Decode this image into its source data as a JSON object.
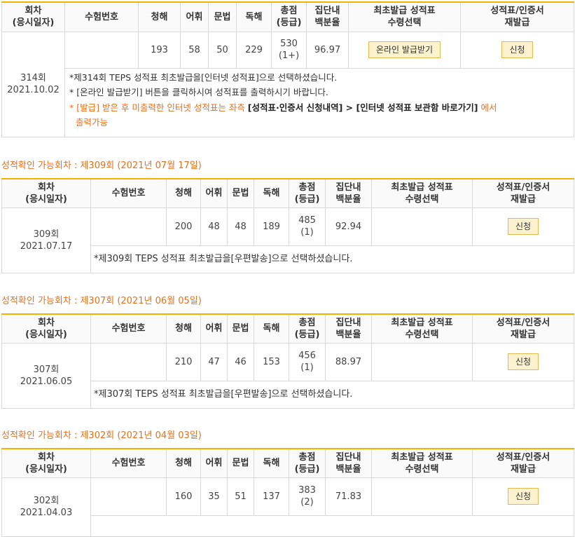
{
  "headers": {
    "session": [
      "회차",
      "(응시일자)"
    ],
    "exam_no": "수험번호",
    "listening": "청해",
    "vocab": "어휘",
    "grammar": "문법",
    "reading": "독해",
    "total": [
      "총점",
      "(등급)"
    ],
    "percentile": [
      "집단내",
      "백분율"
    ],
    "first_issue": [
      "최초발급 성적표",
      "수령선택"
    ],
    "reissue": [
      "성적표/인증서",
      "재발급"
    ]
  },
  "records": [
    {
      "session": "314회",
      "date": "2021.10.02",
      "exam_no": "",
      "listening": "193",
      "vocab": "58",
      "grammar": "50",
      "reading": "229",
      "total": "530",
      "grade": "(1+)",
      "percentile": "96.97",
      "first_issue_button": "온라인 발급받기",
      "reissue_button": "신청",
      "notes": {
        "line1": "*제314회 TEPS 성적표 최초발급을[인터넷 성적표]으로 선택하셨습니다.",
        "line2": "* [온라인 발급받기] 버튼을 클릭하시여 성적표를 출력하시기 바랍니다.",
        "line3_prefix": "* [발급] 받은 후 미출력한 인터넷 성적표는 좌측 ",
        "line3_bold1": "[성적표·인증서 신청내역]",
        "line3_arrow": " > ",
        "line3_bold2": "[인터넷 성적표 보관함 바로가기]",
        "line3_suffix": " 에서",
        "line4": "출력가능"
      }
    }
  ],
  "sections": [
    {
      "title": "성적확인 가능회차 : 제309회 (2021년 07월 17일)",
      "session": "309회",
      "date": "2021.07.17",
      "exam_no": "",
      "listening": "200",
      "vocab": "48",
      "grammar": "48",
      "reading": "189",
      "total": "485",
      "grade": "(1)",
      "percentile": "92.94",
      "reissue_button": "신청",
      "note": "*제309회 TEPS 성적표 최초발급을[우편발송]으로 선택하셨습니다."
    },
    {
      "title": "성적확인 가능회차 : 제307회 (2021년 06월 05일)",
      "session": "307회",
      "date": "2021.06.05",
      "exam_no": "",
      "listening": "210",
      "vocab": "47",
      "grammar": "46",
      "reading": "153",
      "total": "456",
      "grade": "(1)",
      "percentile": "88.97",
      "reissue_button": "신청",
      "note": "*제307회 TEPS 성적표 최초발급을[우편발송]으로 선택하셨습니다."
    },
    {
      "title": "성적확인 가능회차 : 제302회 (2021년 04월 03일)",
      "session": "302회",
      "date": "2021.04.03",
      "exam_no": "",
      "listening": "160",
      "vocab": "35",
      "grammar": "51",
      "reading": "137",
      "total": "383",
      "grade": "(2)",
      "percentile": "71.83",
      "reissue_button": "신청",
      "note": ""
    }
  ],
  "colors": {
    "accent_orange": "#e8701c",
    "header_border": "#f0b400",
    "button_bg": "#fdf2cf",
    "button_border": "#e2b84f"
  }
}
